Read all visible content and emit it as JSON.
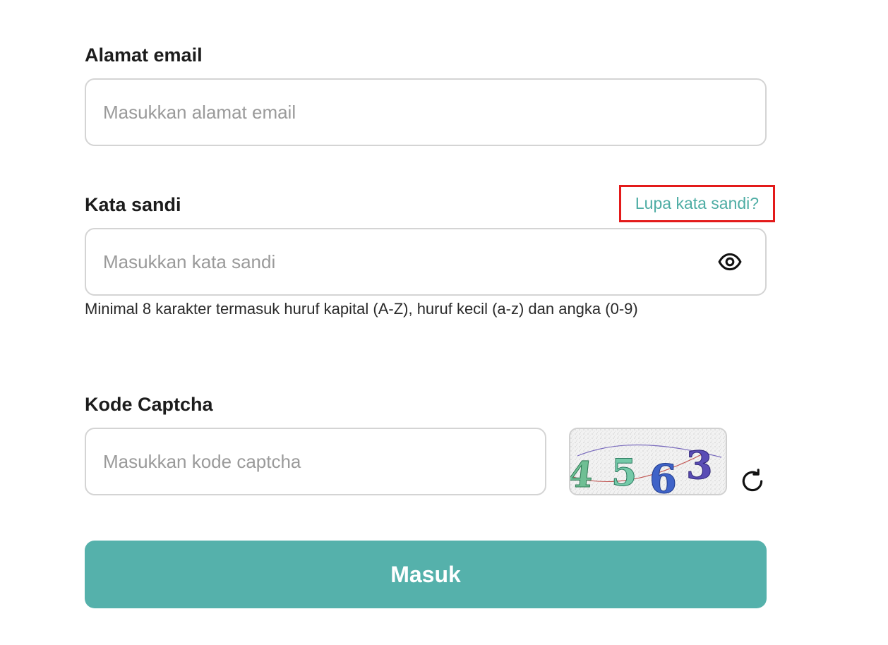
{
  "email": {
    "label": "Alamat email",
    "placeholder": "Masukkan alamat email",
    "value": ""
  },
  "password": {
    "label": "Kata sandi",
    "forgot_link": "Lupa kata sandi?",
    "placeholder": "Masukkan kata sandi",
    "value": "",
    "toggle_icon": "eye-icon",
    "hint": "Minimal 8 karakter termasuk huruf kapital (A-Z), huruf kecil (a-z) dan angka (0-9)"
  },
  "captcha": {
    "label": "Kode Captcha",
    "placeholder": "Masukkan kode captcha",
    "value": "",
    "image_text": "4563",
    "refresh_icon": "refresh-icon"
  },
  "submit": {
    "label": "Masuk"
  },
  "colors": {
    "accent": "#55b1ab",
    "link": "#4eada4",
    "highlight_border": "#e31a1a",
    "field_border": "#d4d4d4",
    "placeholder": "#9a9a9a"
  }
}
